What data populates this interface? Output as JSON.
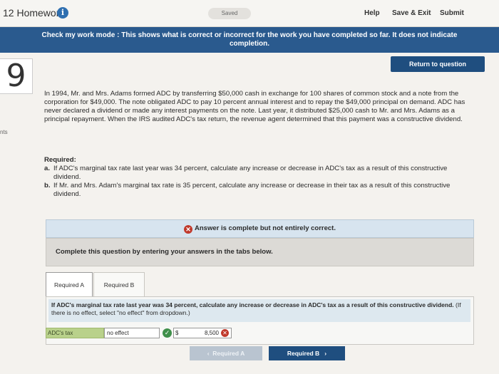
{
  "topbar": {
    "title": "12 Homework",
    "saved": "Saved",
    "help": "Help",
    "save_exit": "Save & Exit",
    "submit": "Submit"
  },
  "banner": {
    "text": "Check my work mode : This shows what is correct or incorrect for the work you have completed so far. It does not indicate completion."
  },
  "return_button": "Return to question",
  "question_number": "9",
  "points_label": "nts",
  "question_text": "In 1994, Mr. and Mrs. Adams formed ADC by transferring $50,000 cash in exchange for 100 shares of common stock and a note from the corporation for $49,000. The note obligated ADC to pay 10 percent annual interest and to repay the $49,000 principal on demand. ADC has never declared a dividend or made any interest payments on the note. Last year, it distributed $25,000 cash to Mr. and Mrs. Adams as a principal repayment. When the IRS audited ADC's tax return, the revenue agent determined that this payment was a constructive dividend.",
  "required": {
    "title": "Required:",
    "a_label": "a.",
    "a_text": "If ADC's marginal tax rate last year was 34 percent, calculate any increase or decrease in ADC's tax as a result of this constructive dividend.",
    "b_label": "b.",
    "b_text": "If Mr. and Mrs. Adam's marginal tax rate is 35 percent, calculate any increase or decrease in their tax as a result of this constructive dividend."
  },
  "answer_status": "Answer is complete but not entirely correct.",
  "complete_prompt": "Complete this question by entering your answers in the tabs below.",
  "tabs": {
    "a": "Required A",
    "b": "Required B"
  },
  "tab_instruction": "If ADC's marginal tax rate last year was 34 percent, calculate any increase or decrease in ADC's tax as a result of this constructive dividend.",
  "tab_hint": "(If there is no effect, select \"no effect\" from dropdown.)",
  "answer_row": {
    "label": "ADC's tax",
    "select_value": "no effect",
    "currency": "$",
    "amount": "8,500"
  },
  "nav": {
    "prev": "Required A",
    "next": "Required B"
  }
}
